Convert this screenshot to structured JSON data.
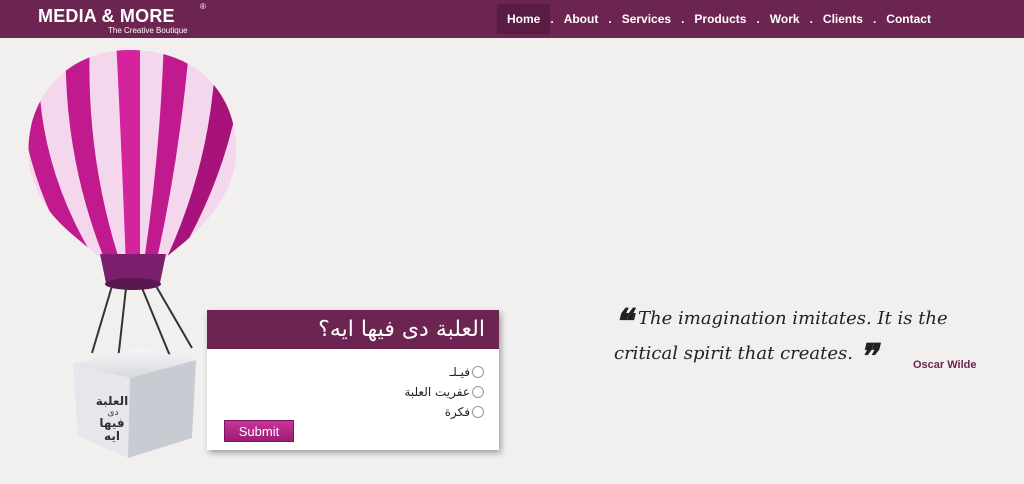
{
  "header": {
    "logo_title": "MEDIA & MORE",
    "logo_reg": "®",
    "logo_tagline": "The Creative Boutique",
    "nav": [
      "Home",
      "About",
      "Services",
      "Products",
      "Work",
      "Clients",
      "Contact"
    ],
    "nav_separator": ".",
    "active": "Home",
    "bg_color": "#6b2550"
  },
  "box_label": {
    "line1": "العلبة",
    "line2": "دى",
    "line3": "فيها",
    "line4": "ايه"
  },
  "poll": {
    "question": "العلبة دى فيها ايه؟",
    "options": [
      "فيـلـ",
      "عفريت العلبة",
      "فكرة"
    ],
    "submit_label": "Submit"
  },
  "quote": {
    "open_mark": "❝",
    "text": "The imagination imitates. It is the critical spirit that creates.",
    "close_mark": "❞",
    "author": "Oscar Wilde"
  }
}
